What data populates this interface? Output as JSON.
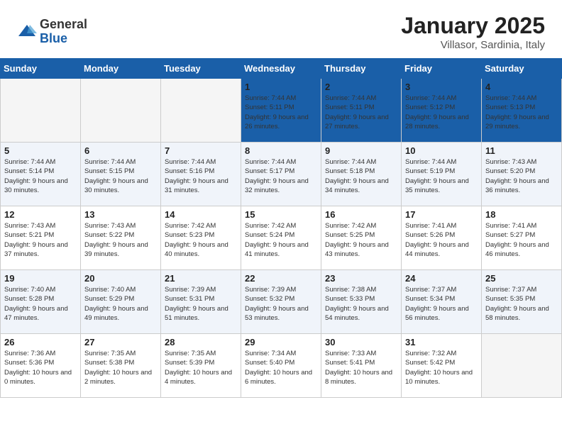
{
  "header": {
    "logo_general": "General",
    "logo_blue": "Blue",
    "month_title": "January 2025",
    "location": "Villasor, Sardinia, Italy"
  },
  "days_of_week": [
    "Sunday",
    "Monday",
    "Tuesday",
    "Wednesday",
    "Thursday",
    "Friday",
    "Saturday"
  ],
  "weeks": [
    [
      {
        "day": "",
        "info": ""
      },
      {
        "day": "",
        "info": ""
      },
      {
        "day": "",
        "info": ""
      },
      {
        "day": "1",
        "info": "Sunrise: 7:44 AM\nSunset: 5:11 PM\nDaylight: 9 hours and 26 minutes."
      },
      {
        "day": "2",
        "info": "Sunrise: 7:44 AM\nSunset: 5:11 PM\nDaylight: 9 hours and 27 minutes."
      },
      {
        "day": "3",
        "info": "Sunrise: 7:44 AM\nSunset: 5:12 PM\nDaylight: 9 hours and 28 minutes."
      },
      {
        "day": "4",
        "info": "Sunrise: 7:44 AM\nSunset: 5:13 PM\nDaylight: 9 hours and 29 minutes."
      }
    ],
    [
      {
        "day": "5",
        "info": "Sunrise: 7:44 AM\nSunset: 5:14 PM\nDaylight: 9 hours and 30 minutes."
      },
      {
        "day": "6",
        "info": "Sunrise: 7:44 AM\nSunset: 5:15 PM\nDaylight: 9 hours and 30 minutes."
      },
      {
        "day": "7",
        "info": "Sunrise: 7:44 AM\nSunset: 5:16 PM\nDaylight: 9 hours and 31 minutes."
      },
      {
        "day": "8",
        "info": "Sunrise: 7:44 AM\nSunset: 5:17 PM\nDaylight: 9 hours and 32 minutes."
      },
      {
        "day": "9",
        "info": "Sunrise: 7:44 AM\nSunset: 5:18 PM\nDaylight: 9 hours and 34 minutes."
      },
      {
        "day": "10",
        "info": "Sunrise: 7:44 AM\nSunset: 5:19 PM\nDaylight: 9 hours and 35 minutes."
      },
      {
        "day": "11",
        "info": "Sunrise: 7:43 AM\nSunset: 5:20 PM\nDaylight: 9 hours and 36 minutes."
      }
    ],
    [
      {
        "day": "12",
        "info": "Sunrise: 7:43 AM\nSunset: 5:21 PM\nDaylight: 9 hours and 37 minutes."
      },
      {
        "day": "13",
        "info": "Sunrise: 7:43 AM\nSunset: 5:22 PM\nDaylight: 9 hours and 39 minutes."
      },
      {
        "day": "14",
        "info": "Sunrise: 7:42 AM\nSunset: 5:23 PM\nDaylight: 9 hours and 40 minutes."
      },
      {
        "day": "15",
        "info": "Sunrise: 7:42 AM\nSunset: 5:24 PM\nDaylight: 9 hours and 41 minutes."
      },
      {
        "day": "16",
        "info": "Sunrise: 7:42 AM\nSunset: 5:25 PM\nDaylight: 9 hours and 43 minutes."
      },
      {
        "day": "17",
        "info": "Sunrise: 7:41 AM\nSunset: 5:26 PM\nDaylight: 9 hours and 44 minutes."
      },
      {
        "day": "18",
        "info": "Sunrise: 7:41 AM\nSunset: 5:27 PM\nDaylight: 9 hours and 46 minutes."
      }
    ],
    [
      {
        "day": "19",
        "info": "Sunrise: 7:40 AM\nSunset: 5:28 PM\nDaylight: 9 hours and 47 minutes."
      },
      {
        "day": "20",
        "info": "Sunrise: 7:40 AM\nSunset: 5:29 PM\nDaylight: 9 hours and 49 minutes."
      },
      {
        "day": "21",
        "info": "Sunrise: 7:39 AM\nSunset: 5:31 PM\nDaylight: 9 hours and 51 minutes."
      },
      {
        "day": "22",
        "info": "Sunrise: 7:39 AM\nSunset: 5:32 PM\nDaylight: 9 hours and 53 minutes."
      },
      {
        "day": "23",
        "info": "Sunrise: 7:38 AM\nSunset: 5:33 PM\nDaylight: 9 hours and 54 minutes."
      },
      {
        "day": "24",
        "info": "Sunrise: 7:37 AM\nSunset: 5:34 PM\nDaylight: 9 hours and 56 minutes."
      },
      {
        "day": "25",
        "info": "Sunrise: 7:37 AM\nSunset: 5:35 PM\nDaylight: 9 hours and 58 minutes."
      }
    ],
    [
      {
        "day": "26",
        "info": "Sunrise: 7:36 AM\nSunset: 5:36 PM\nDaylight: 10 hours and 0 minutes."
      },
      {
        "day": "27",
        "info": "Sunrise: 7:35 AM\nSunset: 5:38 PM\nDaylight: 10 hours and 2 minutes."
      },
      {
        "day": "28",
        "info": "Sunrise: 7:35 AM\nSunset: 5:39 PM\nDaylight: 10 hours and 4 minutes."
      },
      {
        "day": "29",
        "info": "Sunrise: 7:34 AM\nSunset: 5:40 PM\nDaylight: 10 hours and 6 minutes."
      },
      {
        "day": "30",
        "info": "Sunrise: 7:33 AM\nSunset: 5:41 PM\nDaylight: 10 hours and 8 minutes."
      },
      {
        "day": "31",
        "info": "Sunrise: 7:32 AM\nSunset: 5:42 PM\nDaylight: 10 hours and 10 minutes."
      },
      {
        "day": "",
        "info": ""
      }
    ]
  ]
}
